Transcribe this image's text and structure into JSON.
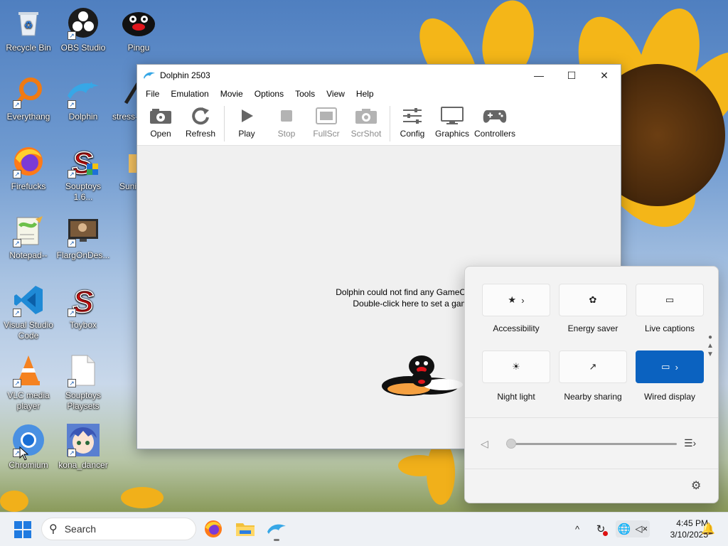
{
  "desktop": {
    "icons": [
      {
        "label": "Recycle Bin"
      },
      {
        "label": "OBS Studio"
      },
      {
        "label": "Pingu"
      },
      {
        "label": "Everythang"
      },
      {
        "label": "Dolphin"
      },
      {
        "label": "stress-"
      },
      {
        "label": "Firefucks"
      },
      {
        "label": "Souptoys 1.6..."
      },
      {
        "label": "Suni"
      },
      {
        "label": "Notepad--"
      },
      {
        "label": "FlargOnDes..."
      },
      {
        "label": "Visual Studio Code"
      },
      {
        "label": "Toybox"
      },
      {
        "label": "VLC media player"
      },
      {
        "label": "Souptoys Playsets"
      },
      {
        "label": "Chromium"
      },
      {
        "label": "kona_dancer"
      }
    ]
  },
  "window": {
    "title": "Dolphin 2503",
    "menu": [
      "File",
      "Emulation",
      "Movie",
      "Options",
      "Tools",
      "View",
      "Help"
    ],
    "toolbar": {
      "open": "Open",
      "refresh": "Refresh",
      "play": "Play",
      "stop": "Stop",
      "fullscr": "FullScr",
      "scrshot": "ScrShot",
      "config": "Config",
      "graphics": "Graphics",
      "controllers": "Controllers"
    },
    "message_line1": "Dolphin could not find any GameCube/Wii ISOs or W",
    "message_line2": "Double-click here to set a games directory..."
  },
  "quick_settings": {
    "tiles": [
      {
        "label": "Accessibility"
      },
      {
        "label": "Energy saver"
      },
      {
        "label": "Live captions"
      },
      {
        "label": "Night light"
      },
      {
        "label": "Nearby sharing"
      },
      {
        "label": "Wired display"
      }
    ],
    "volume_level": 0,
    "accent": "#0b62c0"
  },
  "taskbar": {
    "search_placeholder": "Search",
    "time": "4:45 PM",
    "date": "3/10/2025"
  }
}
